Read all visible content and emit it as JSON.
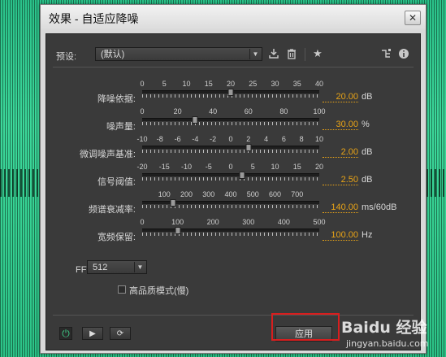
{
  "window": {
    "title": "效果 - 自适应降噪",
    "close_symbol": "✕"
  },
  "preset": {
    "label": "预设:",
    "value": "(默认)"
  },
  "toolbar": {
    "save_icon": "download-icon",
    "delete_icon": "trash-icon",
    "favorite_icon": "star-icon",
    "routing_icon": "routing-icon",
    "info_icon": "info-icon"
  },
  "sliders": [
    {
      "name": "降噪依据:",
      "scale": [
        "0",
        "5",
        "10",
        "15",
        "20",
        "25",
        "30",
        "35",
        "40"
      ],
      "min": 0,
      "max": 40,
      "value": 20,
      "display": "20.00",
      "unit": "dB"
    },
    {
      "name": "噪声量:",
      "scale": [
        "0",
        "20",
        "40",
        "60",
        "80",
        "100"
      ],
      "min": 0,
      "max": 100,
      "value": 30,
      "display": "30.00",
      "unit": "%"
    },
    {
      "name": "微调噪声基准:",
      "scale": [
        "-10",
        "-8",
        "-6",
        "-4",
        "-2",
        "0",
        "2",
        "4",
        "6",
        "8",
        "10"
      ],
      "min": -10,
      "max": 10,
      "value": 2,
      "display": "2.00",
      "unit": "dB"
    },
    {
      "name": "信号阈值:",
      "scale": [
        "-20",
        "-15",
        "-10",
        "-5",
        "0",
        "5",
        "10",
        "15",
        "20"
      ],
      "min": -20,
      "max": 20,
      "value": 2.5,
      "display": "2.50",
      "unit": "dB"
    },
    {
      "name": "频谱衰减率:",
      "scale": [
        "100",
        "200",
        "300",
        "400",
        "500",
        "600",
        "700"
      ],
      "min": 0,
      "max": 800,
      "value": 140,
      "display": "140.00",
      "unit": "ms/60dB"
    },
    {
      "name": "宽频保留:",
      "scale": [
        "0",
        "100",
        "200",
        "300",
        "400",
        "500"
      ],
      "min": 0,
      "max": 500,
      "value": 100,
      "display": "100.00",
      "unit": "Hz"
    }
  ],
  "fft": {
    "label": "FFT 大小:",
    "value": "512"
  },
  "high_quality": {
    "label": "高品质模式(慢)",
    "checked": false
  },
  "bottom": {
    "play_symbol": "▶",
    "loop_symbol": "⟳",
    "power_symbol": "⏻"
  },
  "apply_label": "应用",
  "watermark": {
    "brand": "Baidu 经验",
    "url": "jingyan.baidu.com"
  },
  "colors": {
    "value_accent": "#e8a317",
    "highlight": "#d81e1e",
    "panel_bg": "#3a3a3a"
  }
}
